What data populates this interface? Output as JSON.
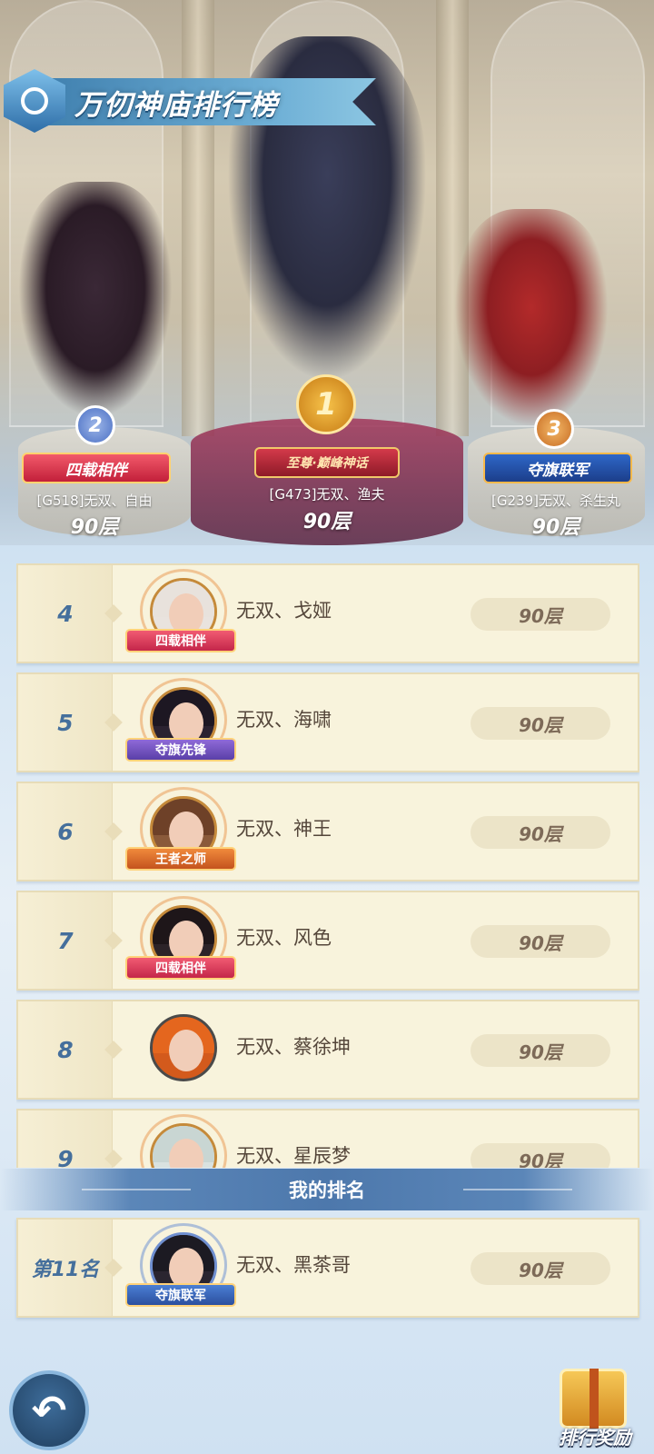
{
  "header": {
    "title": "万仞神庙排行榜",
    "emblem_icon": "eye-crest-icon"
  },
  "podium": [
    {
      "rank": "1",
      "title_badge": "至尊·巅峰神话",
      "name": "[G473]无双、渔夫",
      "floor": "90层"
    },
    {
      "rank": "2",
      "title_badge": "四载相伴",
      "name": "[G518]无双、自由",
      "floor": "90层"
    },
    {
      "rank": "3",
      "title_badge": "夺旗联军",
      "name": "[G239]无双、杀生丸",
      "floor": "90层"
    }
  ],
  "ranking": [
    {
      "rank": "4",
      "name": "无双、戈娅",
      "floor": "90层",
      "badge": "四载相伴",
      "badge_color": "#e33a5a"
    },
    {
      "rank": "5",
      "name": "无双、海啸",
      "floor": "90层",
      "badge": "夺旗先锋",
      "badge_color": "#6b4cc0"
    },
    {
      "rank": "6",
      "name": "无双、神王",
      "floor": "90层",
      "badge": "王者之师",
      "badge_color": "#dd6a2c"
    },
    {
      "rank": "7",
      "name": "无双、风色",
      "floor": "90层",
      "badge": "四载相伴",
      "badge_color": "#e33a5a"
    },
    {
      "rank": "8",
      "name": "无双、蔡徐坤",
      "floor": "90层",
      "badge": "",
      "badge_color": ""
    },
    {
      "rank": "9",
      "name": "无双、星辰梦",
      "floor": "90层",
      "badge": "",
      "badge_color": ""
    }
  ],
  "my_rank": {
    "section_label": "我的排名",
    "rank": "第11名",
    "name": "无双、黑茶哥",
    "floor": "90层",
    "badge": "夺旗联军"
  },
  "footer": {
    "back_icon": "undo-arrow-icon",
    "reward_label": "排行奖励",
    "reward_icon": "gift-box-icon"
  },
  "colors": {
    "accent_blue": "#456f9c",
    "row_bg": "#f8f3dc",
    "pill_bg": "#ece4c8"
  }
}
